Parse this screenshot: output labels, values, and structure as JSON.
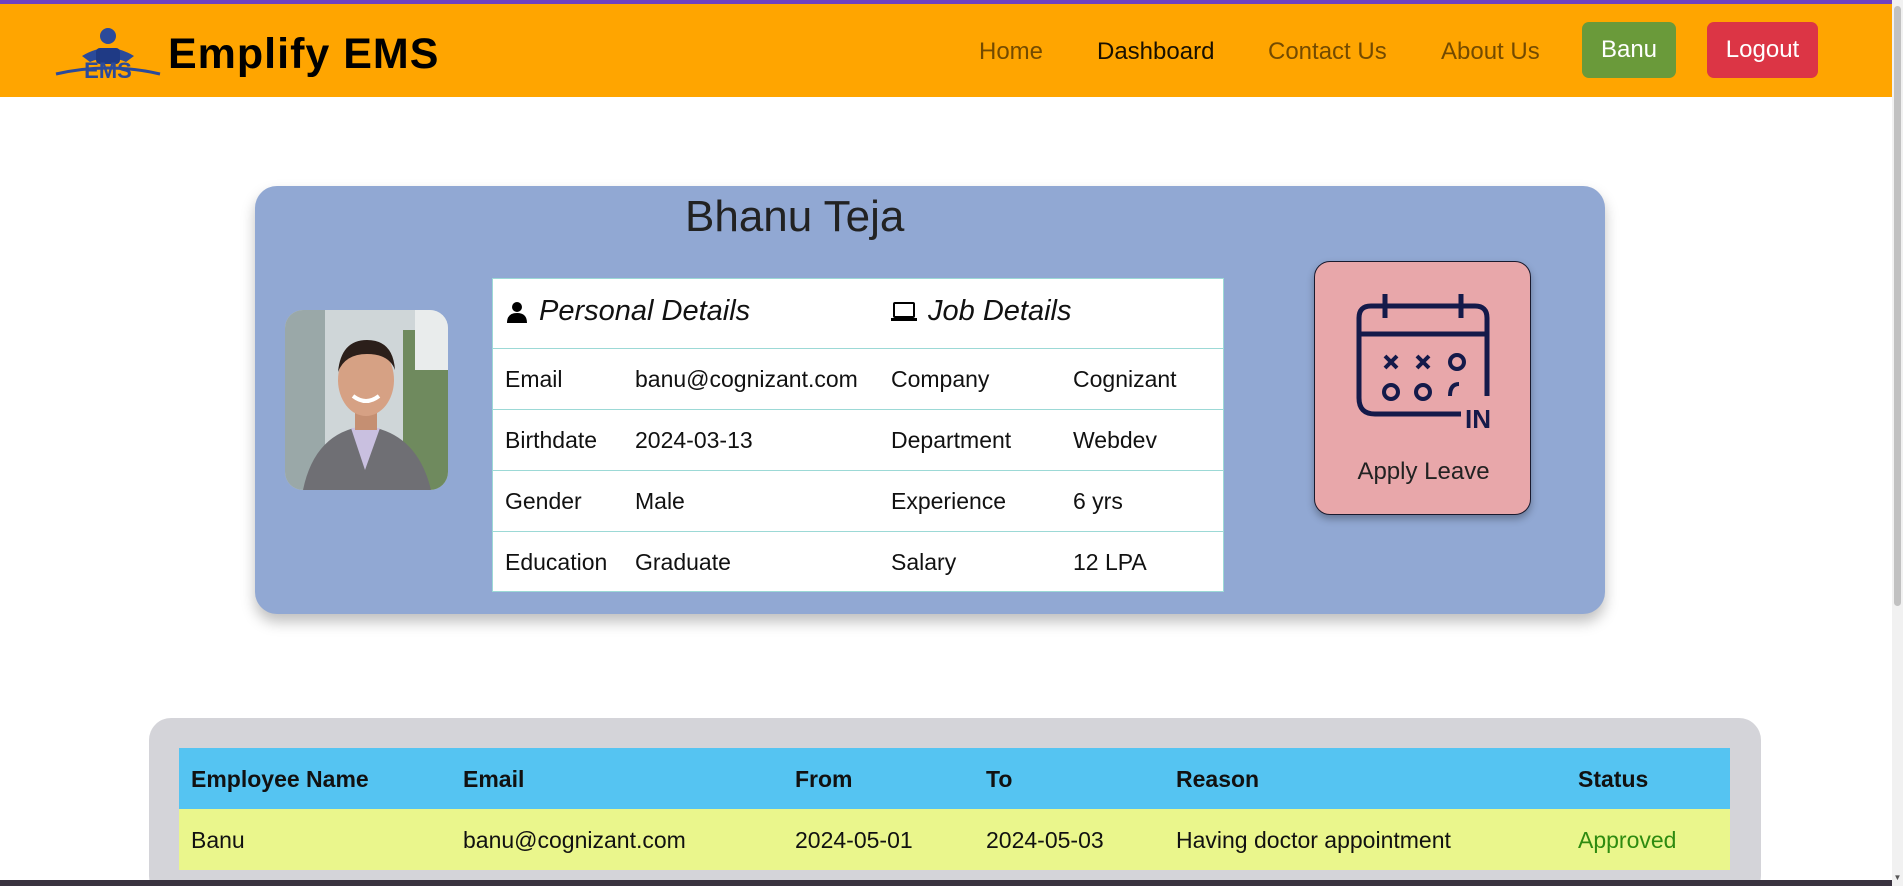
{
  "brand": {
    "name": "Emplify EMS",
    "logo_text": "EMS"
  },
  "nav": {
    "links": [
      "Home",
      "Dashboard",
      "Contact Us",
      "About Us"
    ],
    "active": "Dashboard",
    "user_button": "Banu",
    "logout_button": "Logout"
  },
  "profile": {
    "name": "Bhanu Teja",
    "personal_header": "Personal Details",
    "job_header": "Job Details",
    "rows": [
      {
        "label": "Email",
        "value": "banu@cognizant.com",
        "job_label": "Company",
        "job_value": "Cognizant"
      },
      {
        "label": "Birthdate",
        "value": "2024-03-13",
        "job_label": "Department",
        "job_value": "Webdev"
      },
      {
        "label": "Gender",
        "value": "Male",
        "job_label": "Experience",
        "job_value": "6 yrs"
      },
      {
        "label": "Education",
        "value": "Graduate",
        "job_label": "Salary",
        "job_value": "12 LPA"
      }
    ]
  },
  "apply_leave": {
    "label": "Apply Leave",
    "icon_text": "IN"
  },
  "leaves": {
    "columns": [
      "Employee Name",
      "Email",
      "From",
      "To",
      "Reason",
      "Status"
    ],
    "rows": [
      {
        "name": "Banu",
        "email": "banu@cognizant.com",
        "from": "2024-05-01",
        "to": "2024-05-03",
        "reason": "Having doctor appointment",
        "status": "Approved"
      }
    ]
  },
  "colors": {
    "navbar": "#ffa500",
    "profile_card": "#91a8d3",
    "leave_card": "#e8a7aa",
    "table_header": "#55c4f2",
    "table_row": "#eaf68c",
    "approved": "#2e8b10",
    "user_button": "#6a9a3a",
    "logout_button": "#dc3545"
  }
}
